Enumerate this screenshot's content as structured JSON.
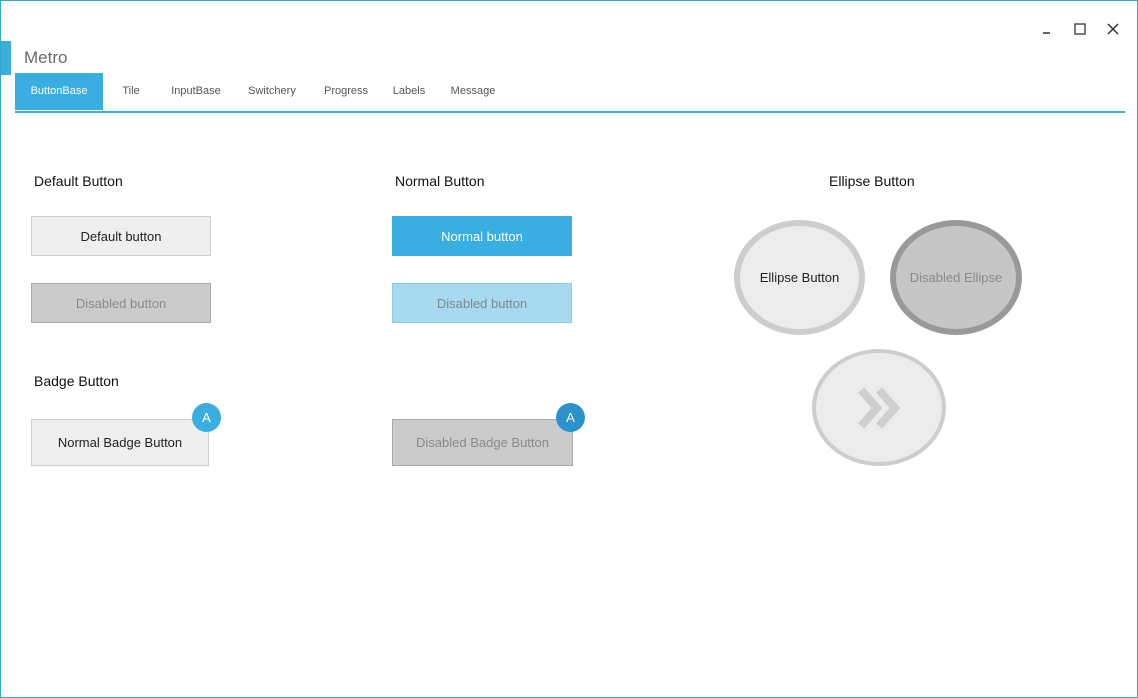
{
  "window": {
    "title": "Metro",
    "controls": [
      "minimize-icon",
      "maximize-icon",
      "close-icon"
    ],
    "accent_color": "#3aaee0"
  },
  "tabs": [
    {
      "label": "ButtonBase",
      "active": true
    },
    {
      "label": "Tile",
      "active": false
    },
    {
      "label": "InputBase",
      "active": false
    },
    {
      "label": "Switchery",
      "active": false
    },
    {
      "label": "Progress",
      "active": false
    },
    {
      "label": "Labels",
      "active": false
    },
    {
      "label": "Message",
      "active": false
    }
  ],
  "sections": {
    "default": {
      "title": "Default Button",
      "button": "Default button",
      "disabled": "Disabled button"
    },
    "normal": {
      "title": "Normal Button",
      "button": "Normal button",
      "disabled": "Disabled button"
    },
    "ellipse": {
      "title": "Ellipse Button",
      "button": "Ellipse Button",
      "disabled": "Disabled Ellipse",
      "arrow_icon": "double-chevron-right-icon"
    },
    "badge": {
      "title": "Badge Button",
      "normal": "Normal Badge Button",
      "disabled": "Disabled Badge Button",
      "badge_normal": "A",
      "badge_disabled": "A",
      "badge_normal_color": "#3aaee0",
      "badge_disabled_color": "#2c92cc"
    }
  }
}
